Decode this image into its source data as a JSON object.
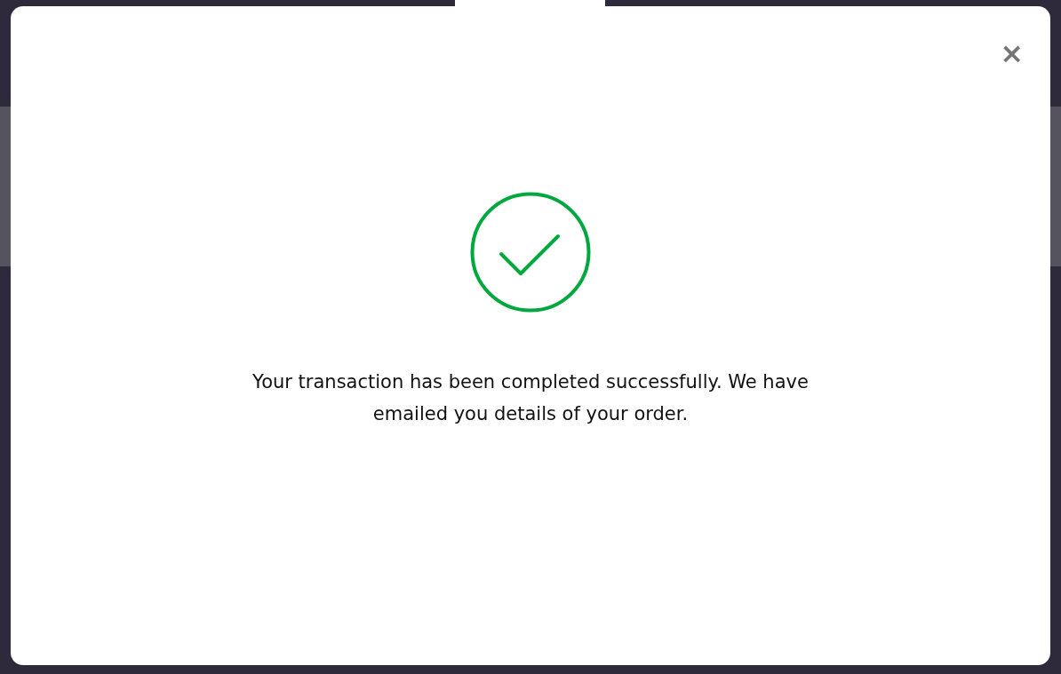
{
  "dialog": {
    "close": "×",
    "message": "Your transaction has been completed successfully. We have emailed you details of your order."
  }
}
